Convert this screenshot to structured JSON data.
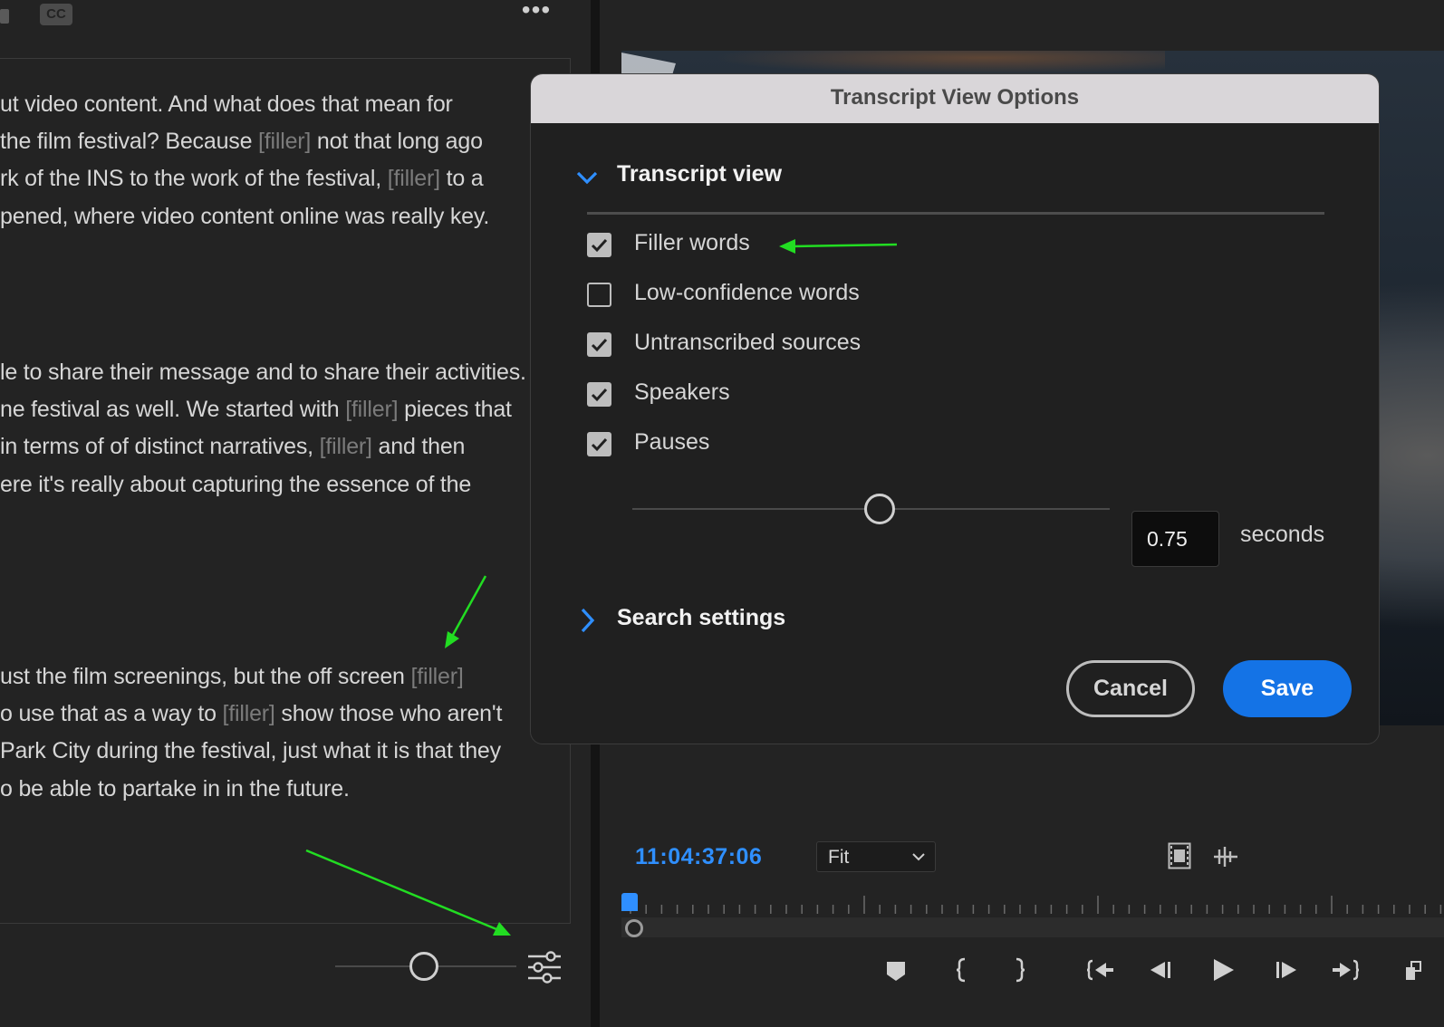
{
  "left_toolbar": {
    "cc_label": "CC",
    "more_label": "•••"
  },
  "transcript": {
    "paragraphs": [
      [
        [
          {
            "t": "ut video content. And what does that mean for"
          }
        ],
        [
          {
            "t": "the film festival? Because "
          },
          {
            "t": "[filler]",
            "f": true
          },
          {
            "t": " not that long ago"
          }
        ],
        [
          {
            "t": "rk of the INS to the work of the festival, "
          },
          {
            "t": "[filler]",
            "f": true
          },
          {
            "t": " to a"
          }
        ],
        [
          {
            "t": "pened, where video content online was really key."
          }
        ]
      ],
      [
        [
          {
            "t": "le to share their message and to share their activities."
          }
        ],
        [
          {
            "t": "ne festival as well. We started with "
          },
          {
            "t": "[filler]",
            "f": true
          },
          {
            "t": " pieces that"
          }
        ],
        [
          {
            "t": " in terms of of distinct narratives, "
          },
          {
            "t": "[filler]",
            "f": true
          },
          {
            "t": " and then"
          }
        ],
        [
          {
            "t": "ere it's really about capturing the essence of the"
          }
        ]
      ],
      [
        [
          {
            "t": "ust the film screenings, but the off screen "
          },
          {
            "t": "[filler]",
            "f": true
          }
        ],
        [
          {
            "t": "o use that as a way to "
          },
          {
            "t": "[filler]",
            "f": true
          },
          {
            "t": " show those who aren't"
          }
        ],
        [
          {
            "t": "Park City during the festival, just what it is that they"
          }
        ],
        [
          {
            "t": "o be able to partake in in the future."
          }
        ]
      ]
    ]
  },
  "dialog": {
    "title": "Transcript View Options",
    "transcript_view": {
      "label": "Transcript view",
      "options": [
        {
          "label": "Filler words",
          "checked": true
        },
        {
          "label": "Low-confidence words",
          "checked": false
        },
        {
          "label": "Untranscribed sources",
          "checked": true
        },
        {
          "label": "Speakers",
          "checked": true
        },
        {
          "label": "Pauses",
          "checked": true
        }
      ],
      "pause_threshold": {
        "value": "0.75",
        "unit": "seconds"
      }
    },
    "search_settings": {
      "label": "Search settings",
      "expanded": false
    },
    "buttons": {
      "cancel": "Cancel",
      "save": "Save"
    }
  },
  "monitor": {
    "timecode": "11:04:37:06",
    "zoom_select": {
      "value": "Fit"
    }
  },
  "colors": {
    "accent": "#2f8fff",
    "save_button": "#1473e6",
    "annotation_arrow": "#22dd22",
    "filler_text": "#7b7b7b"
  }
}
